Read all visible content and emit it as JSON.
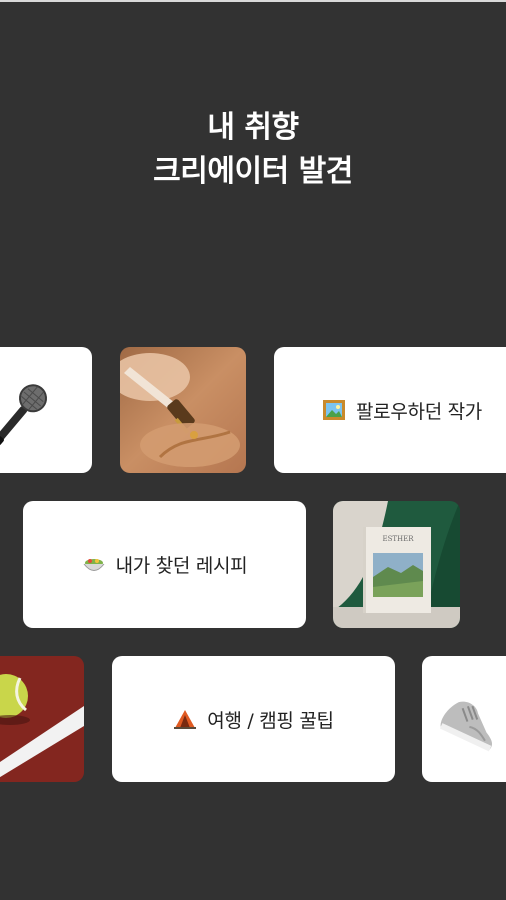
{
  "headline": {
    "line1": "내 취향",
    "line2": "크리에이터 발견"
  },
  "categories": {
    "followed_creators": {
      "label": "팔로우하던 작가",
      "icon": "framed-picture-icon"
    },
    "found_recipes": {
      "label": "내가 찾던 레시피",
      "icon": "bowl-icon"
    },
    "travel_camping": {
      "label": "여행 / 캠핑 꿀팁",
      "icon": "tent-icon"
    }
  },
  "tiles": {
    "microphone": {
      "icon": "microphone-icon"
    },
    "oil_dropper": {
      "image": "dropper-serum-photo"
    },
    "book": {
      "image": "book-cover-photo",
      "book_title": "ESTHER"
    },
    "tennis": {
      "image": "tennis-ball-court-photo"
    },
    "sneaker": {
      "icon": "sneaker-icon"
    }
  },
  "colors": {
    "background": "#323232",
    "card": "#ffffff",
    "text": "#222222"
  }
}
